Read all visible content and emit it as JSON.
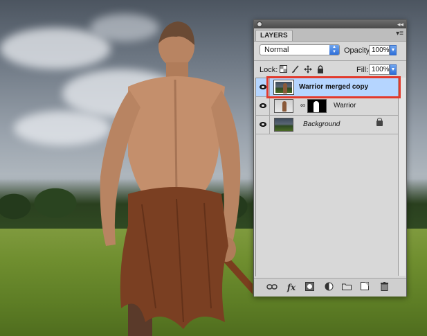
{
  "panel": {
    "tab_label": "LAYERS",
    "blend_mode": "Normal",
    "opacity_label": "Opacity:",
    "opacity_value": "100%",
    "lock_label": "Lock:",
    "fill_label": "Fill:",
    "fill_value": "100%"
  },
  "layers": [
    {
      "name": "Warrior merged copy",
      "selected": true
    },
    {
      "name": "Warrior",
      "selected": false
    },
    {
      "name": "Background",
      "selected": false
    }
  ],
  "icons": {
    "lock_icons": [
      "lock-transparent-icon",
      "lock-paint-icon",
      "lock-move-icon",
      "lock-all-icon"
    ],
    "bottom_icons": [
      "link-layers-icon",
      "fx-icon",
      "add-mask-icon",
      "adjustment-layer-icon",
      "new-group-icon",
      "new-layer-icon",
      "trash-icon"
    ],
    "fx_glyph": "fx"
  },
  "colors": {
    "selection": "#b5d5ff",
    "highlight": "#e23a2c",
    "accent": "#2f6fd9"
  }
}
